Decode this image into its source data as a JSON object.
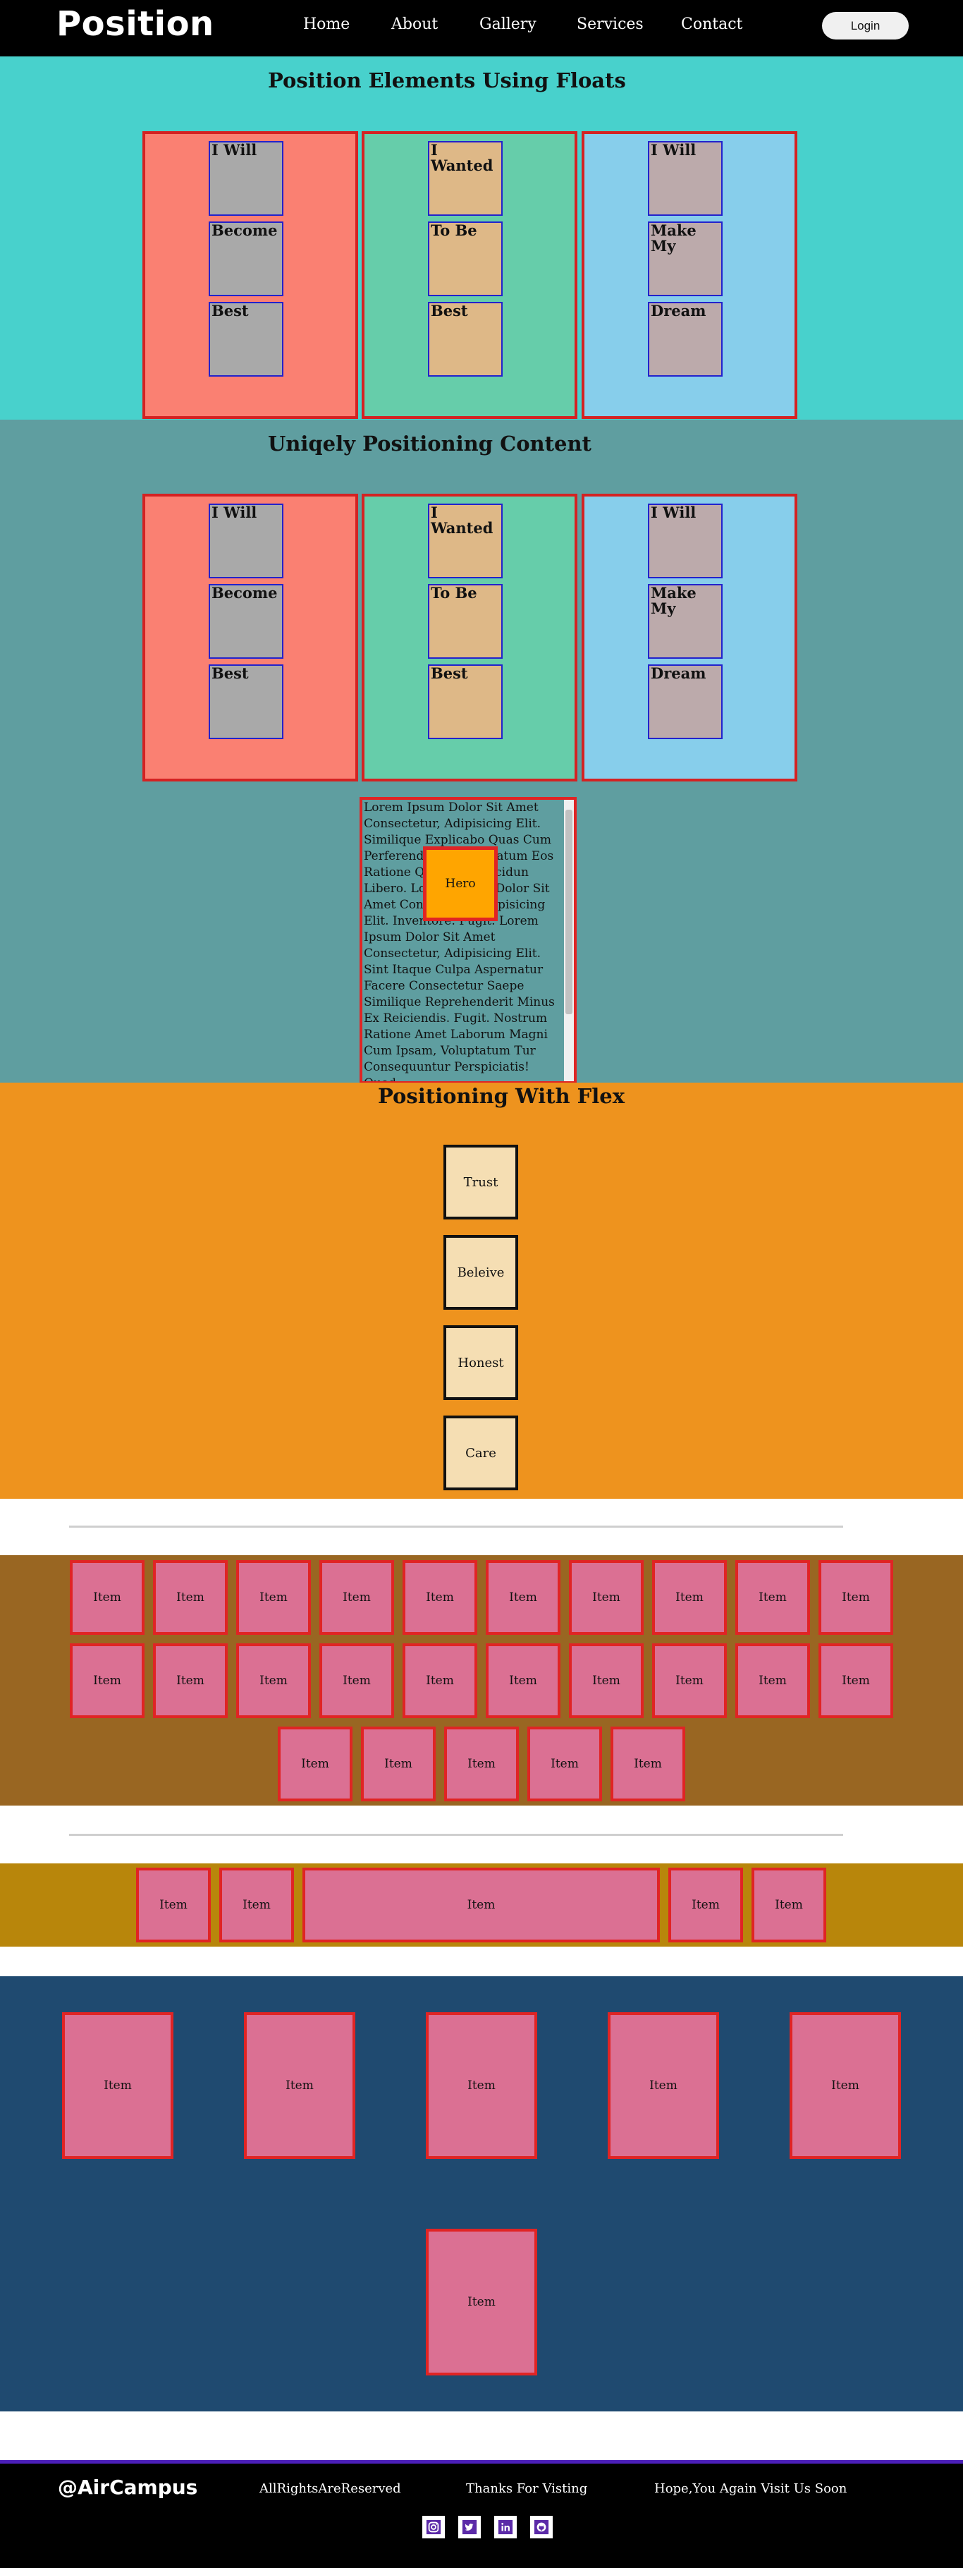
{
  "nav": {
    "brand": "Position",
    "links": [
      "Home",
      "About",
      "Gallery",
      "Services",
      "Contact"
    ],
    "login_label": "Login"
  },
  "floats": {
    "title": "Position Elements Using Floats",
    "columns": [
      [
        "I Will",
        "Become",
        "Best"
      ],
      [
        "I Wanted",
        "To Be",
        "Best"
      ],
      [
        "I Will",
        "Make My",
        "Dream"
      ]
    ]
  },
  "unique": {
    "title": "Uniqely Positioning Content",
    "columns": [
      [
        "I Will",
        "Become",
        "Best"
      ],
      [
        "I Wanted",
        "To Be",
        "Best"
      ],
      [
        "I Will",
        "Make My",
        "Dream"
      ]
    ],
    "scroll_text": "Lorem Ipsum Dolor Sit Amet Consectetur, Adipisicing Elit. Similique Explicabo Quas Cum Perferendis Ab Voluptatum Eos Ratione Quo Enim, Incidun Libero. Lorem Ipsum Dolor Sit Amet Consectetur Adipisicing Elit. Inventore. Fugit. Lorem Ipsum Dolor Sit Amet Consectetur, Adipisicing Elit. Sint Itaque Culpa Aspernatur Facere Consectetur Saepe Similique Reprehenderit Minus Ex Reiciendis. Fugit. Nostrum Ratione Amet Laborum Magni Cum Ipsam, Voluptatum Tur Consequuntur Perspiciatis! Quod",
    "hero_label": "Hero"
  },
  "flex": {
    "title": "Positioning With Flex",
    "items": [
      "Trust",
      "Beleive",
      "Honest",
      "Care"
    ]
  },
  "grid": {
    "item_label": "Item"
  },
  "footer": {
    "brand": "@AirCampus",
    "rights": "AllRightsAreReserved",
    "thanks": "Thanks For Visting",
    "hope": "Hope,You Again Visit Us Soon",
    "social_icons": [
      "instagram-icon",
      "twitter-icon",
      "linkedin-icon",
      "github-icon"
    ]
  },
  "colors": {
    "nav_bg": "#000000",
    "floats_bg": "#48d1cc",
    "unique_bg": "#5f9ea0",
    "flex_bg": "#ee931e",
    "grid_bg": "#996622",
    "grow_bg": "#b8860b",
    "wrap_bg": "#1f4a70",
    "item_bg": "#db7093",
    "border_red": "#e02424"
  }
}
